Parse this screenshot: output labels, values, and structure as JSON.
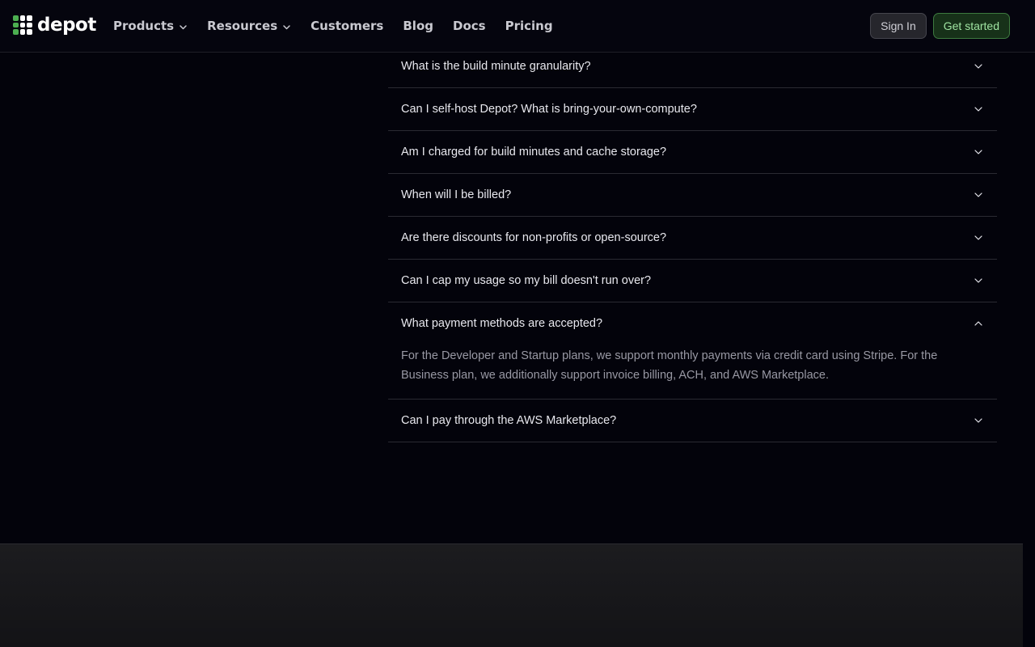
{
  "brand": {
    "name": "depot"
  },
  "nav": {
    "items": [
      {
        "label": "Products",
        "dropdown": true
      },
      {
        "label": "Resources",
        "dropdown": true
      },
      {
        "label": "Customers",
        "dropdown": false
      },
      {
        "label": "Blog",
        "dropdown": false
      },
      {
        "label": "Docs",
        "dropdown": false
      },
      {
        "label": "Pricing",
        "dropdown": false
      }
    ]
  },
  "actions": {
    "sign_in": "Sign In",
    "get_started": "Get started"
  },
  "faq": {
    "items": [
      {
        "question": "What is the build minute granularity?",
        "expanded": false
      },
      {
        "question": "Can I self-host Depot? What is bring-your-own-compute?",
        "expanded": false
      },
      {
        "question": "Am I charged for build minutes and cache storage?",
        "expanded": false
      },
      {
        "question": "When will I be billed?",
        "expanded": false
      },
      {
        "question": "Are there discounts for non-profits or open-source?",
        "expanded": false
      },
      {
        "question": "Can I cap my usage so my bill doesn't run over?",
        "expanded": false
      },
      {
        "question": "What payment methods are accepted?",
        "expanded": true,
        "answer": "For the Developer and Startup plans, we support monthly payments via credit card using Stripe. For the Business plan, we additionally support invoice billing, ACH, and AWS Marketplace."
      },
      {
        "question": "Can I pay through the AWS Marketplace?",
        "expanded": false
      }
    ]
  },
  "colors": {
    "background": "#03030b",
    "accent_green": "#4caf50",
    "divider": "#2a2a32"
  },
  "icons": {
    "collapsed": "chevron-down-icon",
    "expanded": "chevron-up-icon"
  }
}
